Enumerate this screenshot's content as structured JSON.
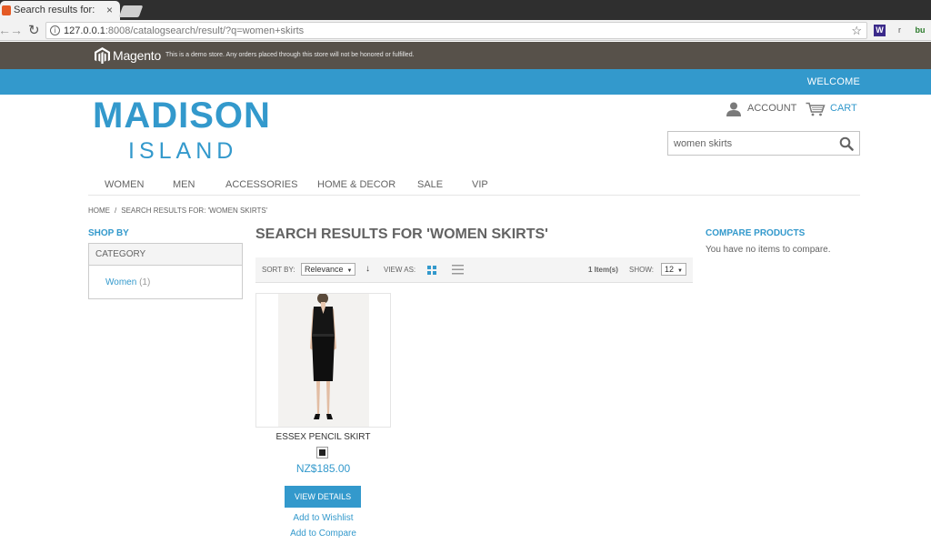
{
  "browser": {
    "tab_title": "Search results for: 'women skirts'",
    "tab_close": "×",
    "url_host": "127.0.0.1",
    "url_rest": ":8008/catalogsearch/result/?q=women+skirts",
    "extensions": [
      "W",
      "r",
      "bu"
    ]
  },
  "notice": {
    "brand": "Magento",
    "message": "This is a demo store. Any orders placed through this store will not be honored or fulfilled."
  },
  "header": {
    "welcome": "WELCOME",
    "logo_line1": "MADISON",
    "logo_line2": "ISLAND",
    "account_label": "ACCOUNT",
    "cart_label": "CART",
    "search_value": "women skirts"
  },
  "nav": {
    "items": [
      "WOMEN",
      "MEN",
      "ACCESSORIES",
      "HOME & DECOR",
      "SALE",
      "VIP"
    ]
  },
  "breadcrumb": {
    "home": "HOME",
    "separator": "/",
    "current": "SEARCH RESULTS FOR: 'WOMEN SKIRTS'"
  },
  "sidebar": {
    "shop_by": "SHOP BY",
    "category_header": "CATEGORY",
    "filter_label": "Women",
    "filter_count": "(1)"
  },
  "main": {
    "title": "SEARCH RESULTS FOR 'WOMEN SKIRTS'",
    "sort_by_label": "SORT BY:",
    "sort_value": "Relevance",
    "view_as_label": "VIEW AS:",
    "item_count": "1 Item(s)",
    "show_label": "SHOW:",
    "show_value": "12"
  },
  "product": {
    "name": "ESSEX PENCIL SKIRT",
    "swatch_color": "#222222",
    "price": "NZ$185.00",
    "view_details": "VIEW DETAILS",
    "add_to_wishlist": "Add to Wishlist",
    "add_to_compare": "Add to Compare"
  },
  "compare": {
    "title": "COMPARE PRODUCTS",
    "text": "You have no items to compare."
  },
  "colors": {
    "accent": "#3399cc",
    "notice_bg": "#57514a"
  }
}
